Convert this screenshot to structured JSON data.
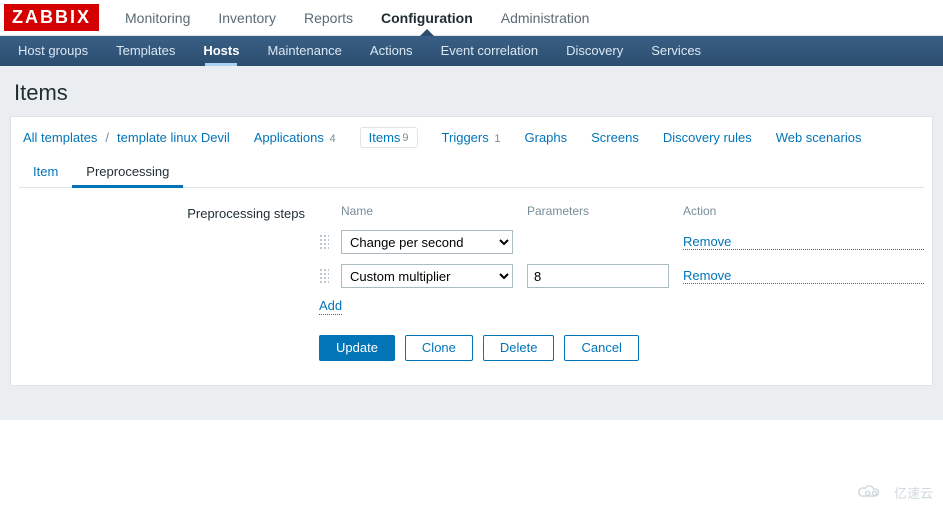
{
  "brand": "ZABBIX",
  "mainnav": [
    {
      "label": "Monitoring",
      "active": false
    },
    {
      "label": "Inventory",
      "active": false
    },
    {
      "label": "Reports",
      "active": false
    },
    {
      "label": "Configuration",
      "active": true
    },
    {
      "label": "Administration",
      "active": false
    }
  ],
  "subnav": [
    {
      "label": "Host groups",
      "active": false
    },
    {
      "label": "Templates",
      "active": false
    },
    {
      "label": "Hosts",
      "active": true
    },
    {
      "label": "Maintenance",
      "active": false
    },
    {
      "label": "Actions",
      "active": false
    },
    {
      "label": "Event correlation",
      "active": false
    },
    {
      "label": "Discovery",
      "active": false
    },
    {
      "label": "Services",
      "active": false
    }
  ],
  "page_title": "Items",
  "breadcrumb": {
    "all_templates": "All templates",
    "template_name": "template linux Devil",
    "applications_label": "Applications",
    "applications_count": "4",
    "items_label": "Items",
    "items_count": "9",
    "triggers_label": "Triggers",
    "triggers_count": "1",
    "graphs_label": "Graphs",
    "screens_label": "Screens",
    "discovery_label": "Discovery rules",
    "web_label": "Web scenarios"
  },
  "tabs": [
    {
      "label": "Item",
      "active": false
    },
    {
      "label": "Preprocessing",
      "active": true
    }
  ],
  "form": {
    "steps_label": "Preprocessing steps",
    "head_name": "Name",
    "head_params": "Parameters",
    "head_action": "Action",
    "steps": [
      {
        "name": "Change per second",
        "param": "",
        "action": "Remove"
      },
      {
        "name": "Custom multiplier",
        "param": "8",
        "action": "Remove"
      }
    ],
    "add_label": "Add",
    "buttons": {
      "update": "Update",
      "clone": "Clone",
      "delete": "Delete",
      "cancel": "Cancel"
    }
  },
  "watermark": "亿速云"
}
